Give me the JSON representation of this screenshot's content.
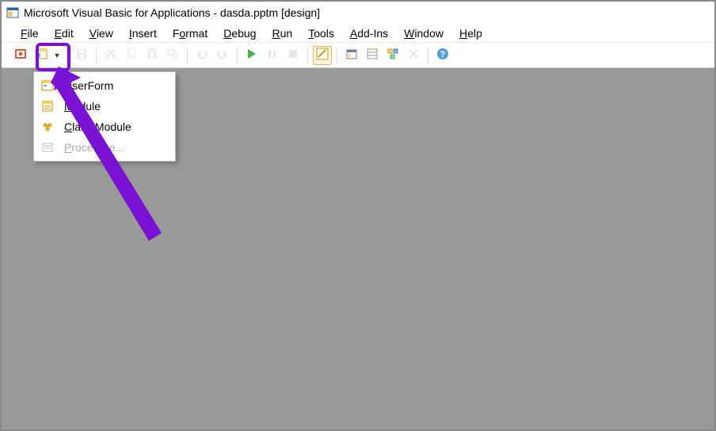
{
  "window": {
    "title": "Microsoft Visual Basic for Applications - dasda.pptm [design]"
  },
  "menu": {
    "items": [
      {
        "label": "File",
        "mn": "F"
      },
      {
        "label": "Edit",
        "mn": "E"
      },
      {
        "label": "View",
        "mn": "V"
      },
      {
        "label": "Insert",
        "mn": "I"
      },
      {
        "label": "Format",
        "mn": "o"
      },
      {
        "label": "Debug",
        "mn": "D"
      },
      {
        "label": "Run",
        "mn": "R"
      },
      {
        "label": "Tools",
        "mn": "T"
      },
      {
        "label": "Add-Ins",
        "mn": "A"
      },
      {
        "label": "Window",
        "mn": "W"
      },
      {
        "label": "Help",
        "mn": "H"
      }
    ]
  },
  "toolbar": {
    "buttons": [
      {
        "name": "view-powerpoint",
        "icon": "ppt",
        "interactable": true
      },
      {
        "name": "insert-object",
        "icon": "insert",
        "interactable": true,
        "split": true,
        "highlighted": true
      },
      {
        "__sep": true
      },
      {
        "name": "save",
        "icon": "save",
        "interactable": true,
        "dim": true
      },
      {
        "__sep": true
      },
      {
        "name": "cut",
        "icon": "cut",
        "interactable": false,
        "dim": true
      },
      {
        "name": "copy",
        "icon": "copy",
        "interactable": false,
        "dim": true
      },
      {
        "name": "paste",
        "icon": "paste",
        "interactable": false,
        "dim": true
      },
      {
        "name": "find",
        "icon": "find",
        "interactable": true,
        "dim": true
      },
      {
        "__sep": true
      },
      {
        "name": "undo",
        "icon": "undo",
        "interactable": false,
        "dim": true
      },
      {
        "name": "redo",
        "icon": "redo",
        "interactable": false,
        "dim": true
      },
      {
        "__sep": true
      },
      {
        "name": "run-sub",
        "icon": "play",
        "interactable": true
      },
      {
        "name": "break",
        "icon": "pause",
        "interactable": false,
        "dim": true
      },
      {
        "name": "reset",
        "icon": "stop",
        "interactable": false,
        "dim": true
      },
      {
        "__sep": true
      },
      {
        "name": "design-mode",
        "icon": "design",
        "interactable": true,
        "active": true
      },
      {
        "__sep": true
      },
      {
        "name": "project-explorer",
        "icon": "project",
        "interactable": true
      },
      {
        "name": "properties-window",
        "icon": "props",
        "interactable": true
      },
      {
        "name": "object-browser",
        "icon": "obj",
        "interactable": true
      },
      {
        "name": "toolbox",
        "icon": "toolbox",
        "interactable": false,
        "dim": true
      },
      {
        "__sep": true
      },
      {
        "name": "help",
        "icon": "help",
        "interactable": true
      }
    ]
  },
  "insert_dropdown": {
    "items": [
      {
        "label": "UserForm",
        "mn": "U",
        "icon": "userform",
        "enabled": true
      },
      {
        "label": "Module",
        "mn": "M",
        "icon": "module",
        "enabled": true
      },
      {
        "label": "Class Module",
        "mn": "C",
        "icon": "class",
        "enabled": true
      },
      {
        "label": "Procedure...",
        "mn": "P",
        "icon": "procedure",
        "enabled": false
      }
    ]
  },
  "annotation": {
    "highlight_target": "insert-object-button",
    "arrow_color": "#7a12d4"
  }
}
